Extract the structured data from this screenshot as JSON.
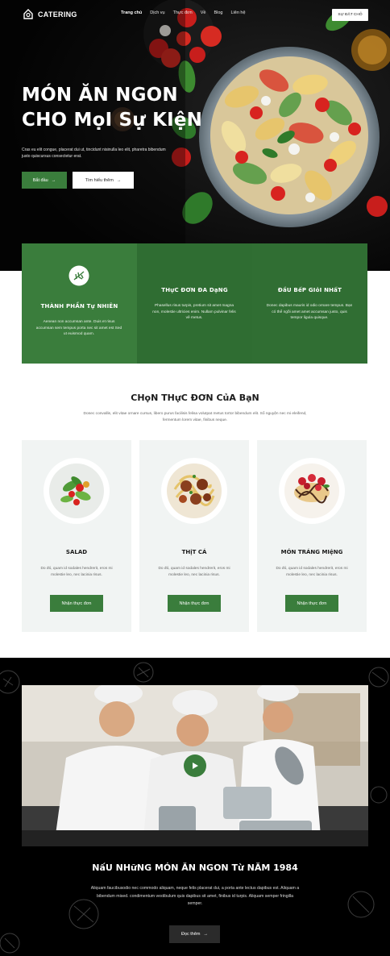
{
  "nav": {
    "logo": "CATERING",
    "items": [
      "Trang chủ",
      "Dịch vụ",
      "Thực đơn",
      "Về",
      "Blog",
      "Liên hệ"
    ],
    "cta": "SỰ ĐẶT CHỖ"
  },
  "hero": {
    "title_line1": "MÓN ĂN NGON",
    "title_line2": "CHO MọI Sự KIệN",
    "description": "Cras eu elit congue, placerat dui ut, tincidunt nisinulla leo elit, pharetra bibendum justo quiscursus consectetur erat.",
    "primary_button": "Bắt đầu",
    "secondary_button": "Tìm hiểu thêm"
  },
  "features": [
    {
      "title": "THÀNH PHẦN Tự NHIÊN",
      "text": "Aenean non accumsan ante. Duis et risus accumsan sem tempus porta nec sit amet est Sed ut euismod quam."
    },
    {
      "title": "THựC ĐƠN ĐA DạNG",
      "text": "Phasellus risus turpis, pretium sit amet magna non, molestie ultricies enim. Nullam pulvinar felis vê metus."
    },
    {
      "title": "ĐầU BếP GIỏI NHấT",
      "text": "Donec dapibus mauris id odio ornare tempus. Bạn có thể ngồi amet amet accumsan justo, quis tempor ligula quisque."
    }
  ],
  "menu_section": {
    "title": "CHọN THựC ĐƠN CủA BạN",
    "description": "Donec convallis, elit vitae ornare cursus, libero purus facilisis felisa volutpat metus tortor bibendum elit. Sổ nguyện nec mi eleifend, fermentum lorem vitae, finibus neque.",
    "cards": [
      {
        "title": "SALAD",
        "text": "Do đó, quam id sodales hendrerit, eros mi molestie leo, nec lacinia risus.",
        "button": "Nhận thực đơn"
      },
      {
        "title": "THịT CÁ",
        "text": "Do đó, quam id sodales hendrerit, eros mi molestie leo, nec lacinia risus.",
        "button": "Nhận thực đơn"
      },
      {
        "title": "MÓN TRÁNG MIệNG",
        "text": "Do đó, quam id sodales hendrerit, eros mi molestie leo, nec lacinia risus.",
        "button": "Nhận thực đơn"
      }
    ]
  },
  "video_section": {
    "title": "NấU NHữNG MÓN ĂN NGON Từ NĂM 1984",
    "description": "Aliquam faucibusodio nec commodo aliquam, neque felis placerat dui, a porta ante lectus dapibus est. Aliquam a bibendum mised. condimentum vestibulum quis dapibus sit amet, finibus id turpis. Aliquam semper fringilla semper.",
    "button": "Đọc thêm"
  },
  "colors": {
    "accent": "#3a7d3c",
    "dark": "#000000",
    "card_bg": "#f1f4f3"
  }
}
